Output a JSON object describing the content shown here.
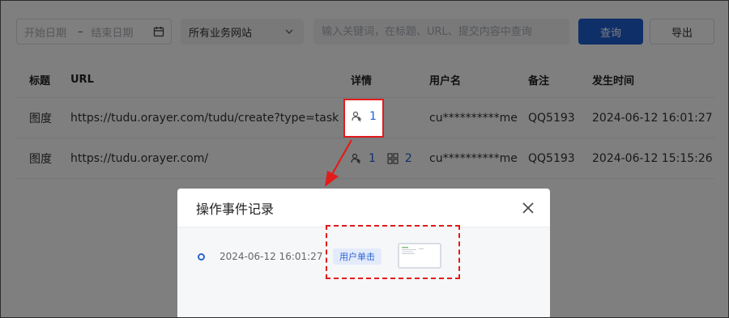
{
  "filters": {
    "start_date_placeholder": "开始日期",
    "date_separator": "–",
    "end_date_placeholder": "结束日期",
    "site_select_value": "所有业务网站",
    "search_placeholder": "输入关键词，在标题、URL、提交内容中查询",
    "query_label": "查询",
    "export_label": "导出"
  },
  "table": {
    "columns": [
      "标题",
      "URL",
      "详情",
      "用户名",
      "备注",
      "发生时间"
    ],
    "rows": [
      {
        "title": "图度",
        "url": "https://tudu.orayer.com/tudu/create?type=task",
        "detail_clicks": "1",
        "detail_pages": "",
        "username": "cu**********me",
        "note": "QQ5193",
        "time": "2024-06-12 16:01:27"
      },
      {
        "title": "图度",
        "url": "https://tudu.orayer.com/",
        "detail_clicks": "1",
        "detail_pages": "2",
        "username": "cu**********me",
        "note": "QQ5193",
        "time": "2024-06-12 15:15:26"
      }
    ]
  },
  "dialog": {
    "title": "操作事件记录",
    "events": [
      {
        "time": "2024-06-12 16:01:27",
        "tag": "用户单击"
      }
    ]
  },
  "colors": {
    "primary": "#1f5fd0",
    "annotation_red": "#e21b1b"
  }
}
